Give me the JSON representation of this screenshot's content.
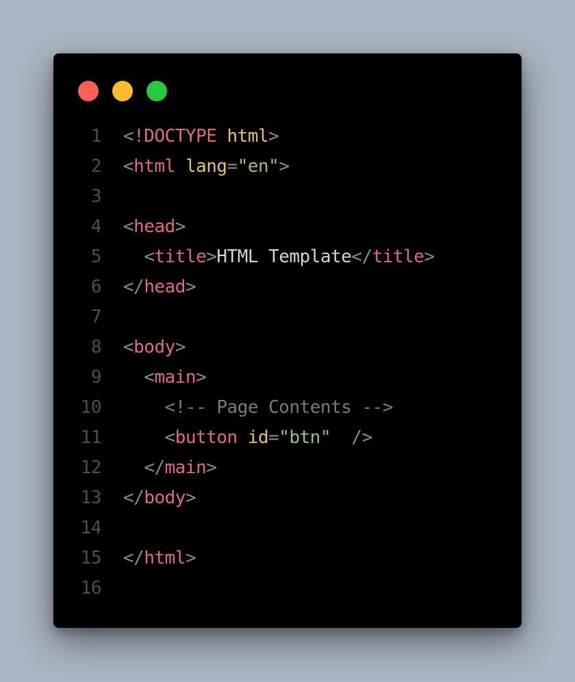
{
  "window": {
    "dots": [
      {
        "color": "#ff5f57"
      },
      {
        "color": "#febc2e"
      },
      {
        "color": "#28c840"
      }
    ]
  },
  "code": {
    "lines": [
      {
        "num": "1",
        "tokens": [
          {
            "text": "<",
            "kind": "p"
          },
          {
            "text": "!DOCTYPE",
            "kind": "t"
          },
          {
            "text": " ",
            "kind": "w"
          },
          {
            "text": "html",
            "kind": "a"
          },
          {
            "text": ">",
            "kind": "p"
          }
        ]
      },
      {
        "num": "2",
        "tokens": [
          {
            "text": "<",
            "kind": "p"
          },
          {
            "text": "html",
            "kind": "t"
          },
          {
            "text": " ",
            "kind": "w"
          },
          {
            "text": "lang",
            "kind": "a"
          },
          {
            "text": "=",
            "kind": "p"
          },
          {
            "text": "\"en\"",
            "kind": "s"
          },
          {
            "text": ">",
            "kind": "p"
          }
        ]
      },
      {
        "num": "3",
        "tokens": []
      },
      {
        "num": "4",
        "tokens": [
          {
            "text": "<",
            "kind": "p"
          },
          {
            "text": "head",
            "kind": "t"
          },
          {
            "text": ">",
            "kind": "p"
          }
        ]
      },
      {
        "num": "5",
        "tokens": [
          {
            "text": "  ",
            "kind": "w"
          },
          {
            "text": "<",
            "kind": "p"
          },
          {
            "text": "title",
            "kind": "t"
          },
          {
            "text": ">",
            "kind": "p"
          },
          {
            "text": "HTML Template",
            "kind": "w"
          },
          {
            "text": "</",
            "kind": "p"
          },
          {
            "text": "title",
            "kind": "t"
          },
          {
            "text": ">",
            "kind": "p"
          }
        ]
      },
      {
        "num": "6",
        "tokens": [
          {
            "text": "</",
            "kind": "p"
          },
          {
            "text": "head",
            "kind": "t"
          },
          {
            "text": ">",
            "kind": "p"
          }
        ]
      },
      {
        "num": "7",
        "tokens": []
      },
      {
        "num": "8",
        "tokens": [
          {
            "text": "<",
            "kind": "p"
          },
          {
            "text": "body",
            "kind": "t"
          },
          {
            "text": ">",
            "kind": "p"
          }
        ]
      },
      {
        "num": "9",
        "tokens": [
          {
            "text": "  ",
            "kind": "w"
          },
          {
            "text": "<",
            "kind": "p"
          },
          {
            "text": "main",
            "kind": "t"
          },
          {
            "text": ">",
            "kind": "p"
          }
        ]
      },
      {
        "num": "10",
        "tokens": [
          {
            "text": "    ",
            "kind": "w"
          },
          {
            "text": "<!-- Page Contents -->",
            "kind": "c"
          }
        ]
      },
      {
        "num": "11",
        "tokens": [
          {
            "text": "    ",
            "kind": "w"
          },
          {
            "text": "<",
            "kind": "p"
          },
          {
            "text": "button",
            "kind": "t"
          },
          {
            "text": " ",
            "kind": "w"
          },
          {
            "text": "id",
            "kind": "a"
          },
          {
            "text": "=",
            "kind": "p"
          },
          {
            "text": "\"btn\"",
            "kind": "s"
          },
          {
            "text": "  ",
            "kind": "w"
          },
          {
            "text": "/>",
            "kind": "p"
          }
        ]
      },
      {
        "num": "12",
        "tokens": [
          {
            "text": "  ",
            "kind": "w"
          },
          {
            "text": "</",
            "kind": "p"
          },
          {
            "text": "main",
            "kind": "t"
          },
          {
            "text": ">",
            "kind": "p"
          }
        ]
      },
      {
        "num": "13",
        "tokens": [
          {
            "text": "</",
            "kind": "p"
          },
          {
            "text": "body",
            "kind": "t"
          },
          {
            "text": ">",
            "kind": "p"
          }
        ]
      },
      {
        "num": "14",
        "tokens": []
      },
      {
        "num": "15",
        "tokens": [
          {
            "text": "</",
            "kind": "p"
          },
          {
            "text": "html",
            "kind": "t"
          },
          {
            "text": ">",
            "kind": "p"
          }
        ]
      },
      {
        "num": "16",
        "tokens": []
      }
    ]
  }
}
